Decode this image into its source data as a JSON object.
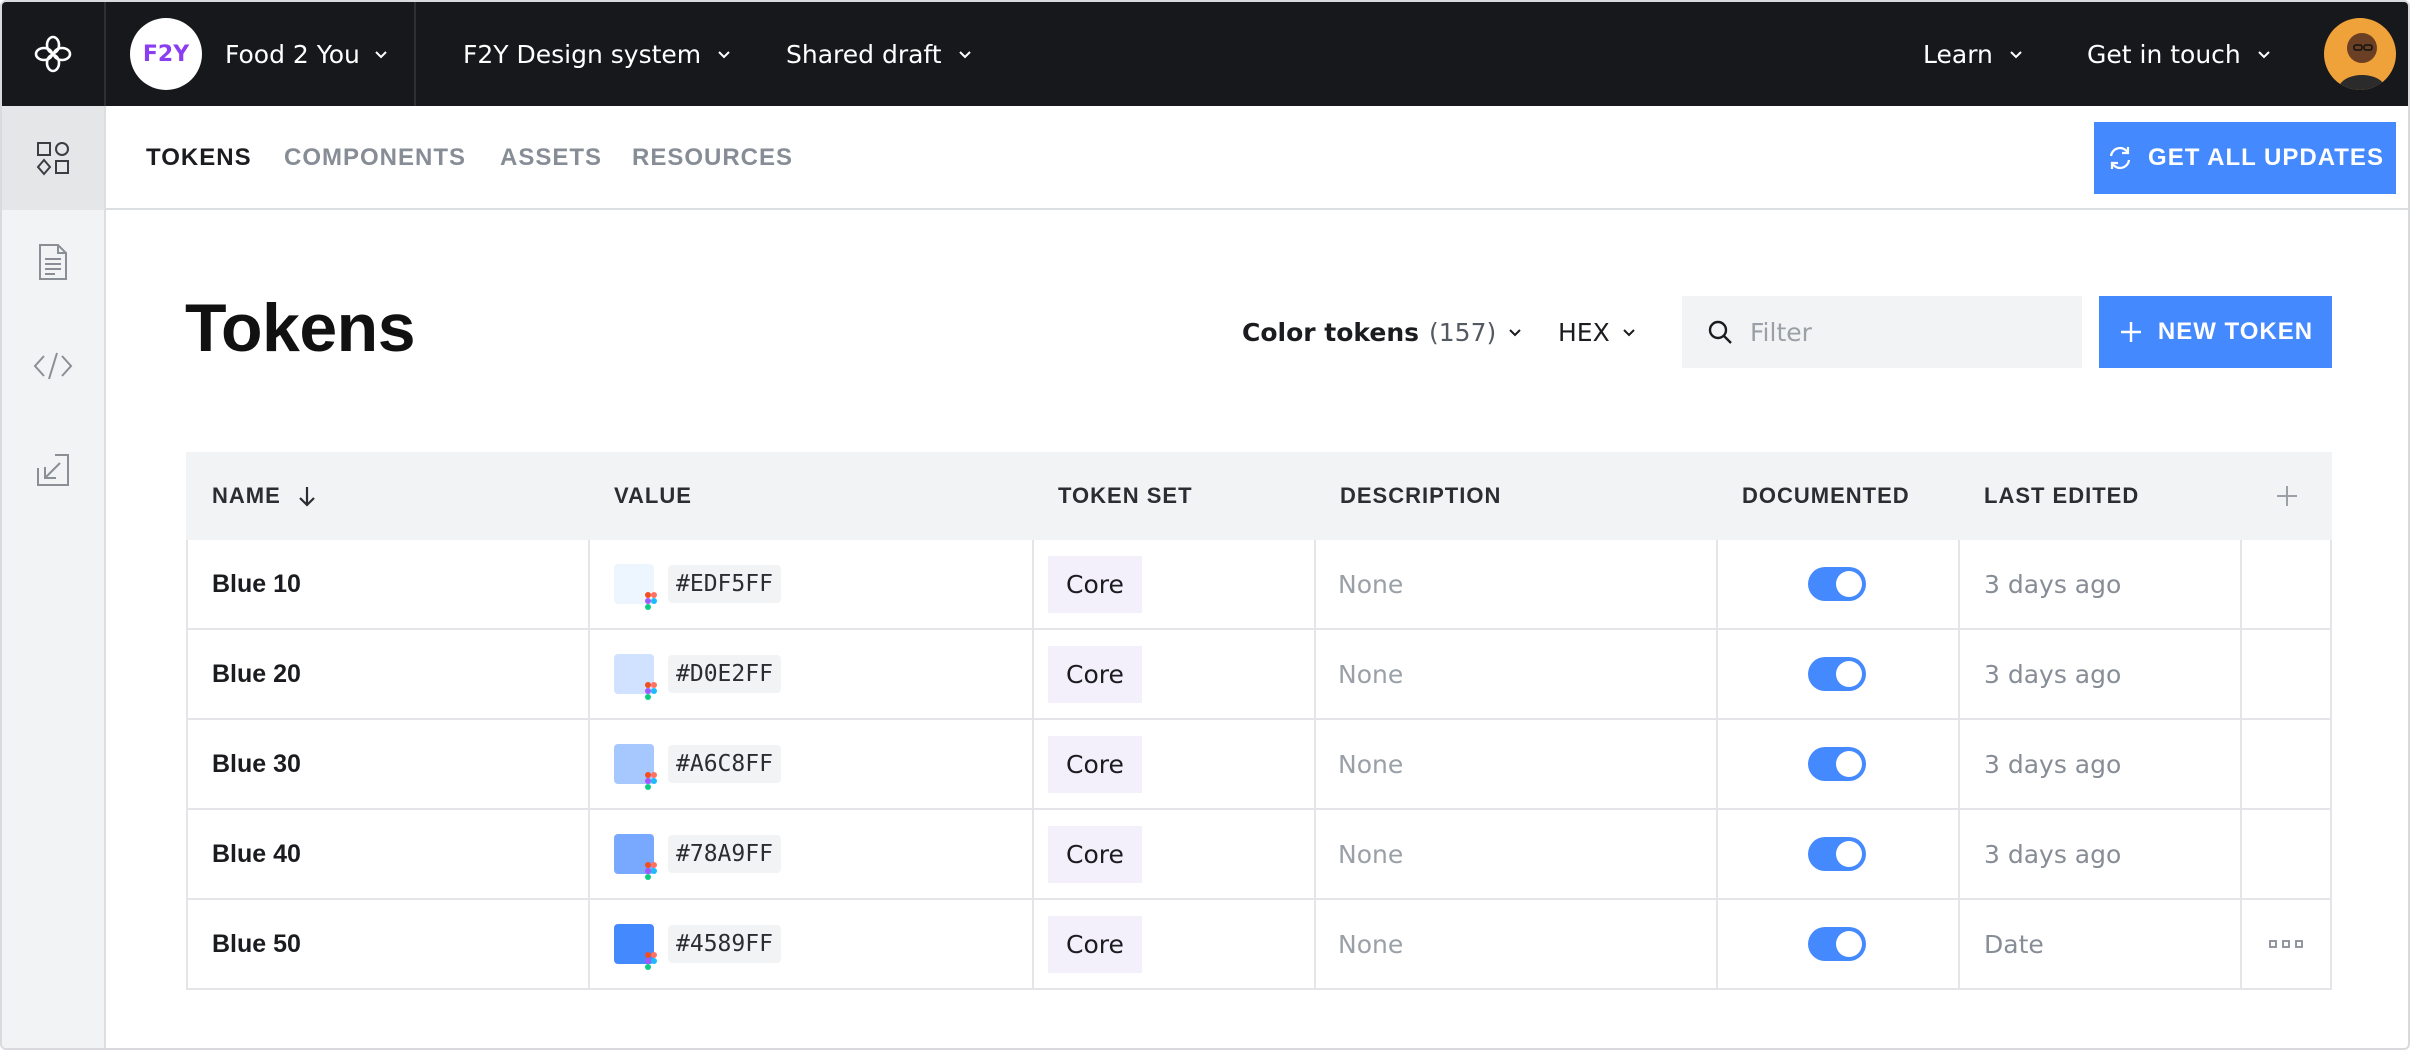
{
  "topbar": {
    "brand_badge": "F2Y",
    "brand_name": "Food 2 You",
    "design_system": "F2Y Design system",
    "draft": "Shared draft",
    "learn": "Learn",
    "contact": "Get in touch"
  },
  "sidebar": {
    "items": [
      {
        "icon": "components-icon",
        "active": true
      },
      {
        "icon": "document-icon",
        "active": false
      },
      {
        "icon": "code-icon",
        "active": false
      },
      {
        "icon": "import-icon",
        "active": false
      }
    ]
  },
  "tabs": [
    {
      "label": "TOKENS",
      "active": true
    },
    {
      "label": "COMPONENTS",
      "active": false
    },
    {
      "label": "ASSETS",
      "active": false
    },
    {
      "label": "RESOURCES",
      "active": false
    }
  ],
  "toolbar": {
    "get_updates_label": "GET ALL UPDATES"
  },
  "page": {
    "title": "Tokens",
    "token_type": "Color tokens",
    "token_count": "(157)",
    "format": "HEX",
    "filter_placeholder": "Filter",
    "new_token_label": "NEW TOKEN"
  },
  "table": {
    "headers": {
      "name": "NAME",
      "value": "VALUE",
      "token_set": "TOKEN SET",
      "description": "DESCRIPTION",
      "documented": "DOCUMENTED",
      "last_edited": "LAST EDITED"
    },
    "rows": [
      {
        "name": "Blue 10",
        "value": "#EDF5FF",
        "color": "#EDF5FF",
        "token_set": "Core",
        "description": "None",
        "documented": true,
        "last_edited": "3 days ago"
      },
      {
        "name": "Blue 20",
        "value": "#D0E2FF",
        "color": "#D0E2FF",
        "token_set": "Core",
        "description": "None",
        "documented": true,
        "last_edited": "3 days ago"
      },
      {
        "name": "Blue 30",
        "value": "#A6C8FF",
        "color": "#A6C8FF",
        "token_set": "Core",
        "description": "None",
        "documented": true,
        "last_edited": "3 days ago"
      },
      {
        "name": "Blue 40",
        "value": "#78A9FF",
        "color": "#78A9FF",
        "token_set": "Core",
        "description": "None",
        "documented": true,
        "last_edited": "3 days ago"
      },
      {
        "name": "Blue 50",
        "value": "#4589FF",
        "color": "#4589FF",
        "token_set": "Core",
        "description": "None",
        "documented": true,
        "last_edited": "Date"
      }
    ]
  },
  "colors": {
    "accent": "#4589ff",
    "topbar": "#16181b",
    "brand_badge_text": "#8b3df0"
  }
}
